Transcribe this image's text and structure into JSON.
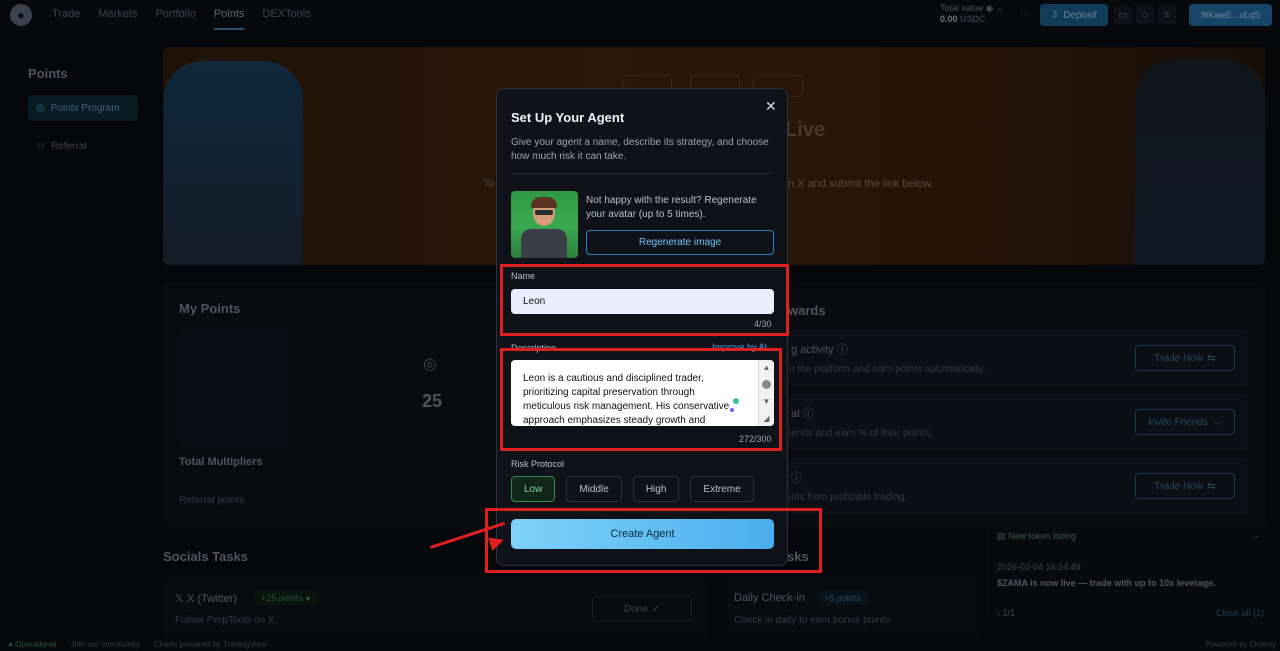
{
  "topbar": {
    "nav": [
      "Trade",
      "Markets",
      "Portfolio",
      "Points",
      "DEXTools"
    ],
    "active_nav": "Points",
    "total_value_label": "Total value",
    "total_value": "0.00",
    "total_value_unit": "USDC",
    "deposit_label": "Deposit",
    "wallet": "9tKawE...uLqS"
  },
  "sidebar": {
    "title": "Points",
    "items": [
      {
        "label": "Points Program",
        "active": true
      },
      {
        "label": "Referral",
        "active": false
      }
    ]
  },
  "banner": {
    "title_fragment": "Live",
    "left_text_fragment": "To",
    "right_text_fragment": "n X and submit the link below."
  },
  "my_points": {
    "title": "My Points",
    "value": "25",
    "total_multipliers": "Total Multipliers",
    "referral_points": "Referral points"
  },
  "rewards": {
    "title_fragment": "wards",
    "rows": [
      {
        "title_fragment": "g activity",
        "desc_fragment": "n the platform and earn points automatically.",
        "button": "Trade Now"
      },
      {
        "title_fragment": "al",
        "desc_fragment": "iends and earn % of their points.",
        "button": "Invite Friends"
      },
      {
        "title_fragment": "",
        "desc_fragment": "ints from profitable trading.",
        "button": "Trade Now"
      }
    ]
  },
  "socials": {
    "title": "Socials Tasks",
    "x_title": "X (Twitter)",
    "x_points": "+25 points",
    "x_desc": "Follow PerpTools on X.",
    "x_button": "Done"
  },
  "daily": {
    "title_fragment": "sks",
    "title": "Daily Check-in",
    "points": "+5 points",
    "desc": "Check in daily to earn bonus points."
  },
  "toast": {
    "title": "New token listing",
    "time": "2026-02-04 16:24:49",
    "message": "$ZAMA is now live — trade with up to 10x leverage.",
    "pager": "1/1",
    "close_all": "Close all (1)"
  },
  "footer": {
    "status": "Operational",
    "community": "Join our community",
    "charts": "Charts powered by TradingView",
    "powered": "Powered by Orderly"
  },
  "modal": {
    "title": "Set Up Your Agent",
    "subtitle": "Give your agent a name, describe its strategy, and choose how much risk it can take.",
    "regen_text": "Not happy with the result? Regenerate your avatar (up to 5 times).",
    "regen_button": "Regenerate image",
    "name_label": "Name",
    "name_value": "Leon",
    "name_counter": "4/30",
    "desc_label": "Description",
    "improve_label": "Improve by AI",
    "desc_value": "Leon is a cautious and disciplined trader, prioritizing capital preservation through meticulous risk management. His conservative approach emphasizes steady growth and",
    "desc_counter": "272/300",
    "risk_label": "Risk Protocol",
    "risk_options": [
      "Low",
      "Middle",
      "High",
      "Extreme"
    ],
    "risk_selected": "Low",
    "create_button": "Create Agent"
  },
  "colors": {
    "accent": "#4aaeee",
    "annotation_red": "#e0201f",
    "selected_green": "#2f8f4a"
  }
}
